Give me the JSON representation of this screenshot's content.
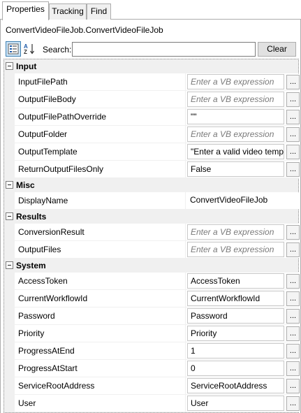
{
  "tabs": [
    "Properties",
    "Tracking",
    "Find"
  ],
  "active_tab": 0,
  "job_title": "ConvertVideoFileJob.ConvertVideoFileJob",
  "toolbar": {
    "categorized_icon": "categorized-sort-icon",
    "alpha_icon": "alphabetical-sort-icon",
    "search_label": "Search:",
    "search_value": "",
    "clear_label": "Clear"
  },
  "categories": [
    {
      "name": "Input",
      "rows": [
        {
          "name": "InputFilePath",
          "value": "Enter a VB expression",
          "placeholder": true,
          "button": true
        },
        {
          "name": "OutputFileBody",
          "value": "Enter a VB expression",
          "placeholder": true,
          "button": true
        },
        {
          "name": "OutputFilePathOverride",
          "value": "\"\"",
          "placeholder": false,
          "button": true
        },
        {
          "name": "OutputFolder",
          "value": "Enter a VB expression",
          "placeholder": true,
          "button": true
        },
        {
          "name": "OutputTemplate",
          "value": "\"Enter a valid video temp",
          "placeholder": false,
          "button": true
        },
        {
          "name": "ReturnOutputFilesOnly",
          "value": "False",
          "placeholder": false,
          "button": true
        }
      ]
    },
    {
      "name": "Misc",
      "rows": [
        {
          "name": "DisplayName",
          "value": "ConvertVideoFileJob",
          "placeholder": false,
          "button": false,
          "plain": true
        }
      ]
    },
    {
      "name": "Results",
      "rows": [
        {
          "name": "ConversionResult",
          "value": "Enter a VB expression",
          "placeholder": true,
          "button": true
        },
        {
          "name": "OutputFiles",
          "value": "Enter a VB expression",
          "placeholder": true,
          "button": true
        }
      ]
    },
    {
      "name": "System",
      "rows": [
        {
          "name": "AccessToken",
          "value": "AccessToken",
          "placeholder": false,
          "button": true
        },
        {
          "name": "CurrentWorkflowId",
          "value": "CurrentWorkflowId",
          "placeholder": false,
          "button": true
        },
        {
          "name": "Password",
          "value": "Password",
          "placeholder": false,
          "button": true
        },
        {
          "name": "Priority",
          "value": "Priority",
          "placeholder": false,
          "button": true
        },
        {
          "name": "ProgressAtEnd",
          "value": "1",
          "placeholder": false,
          "button": true
        },
        {
          "name": "ProgressAtStart",
          "value": "0",
          "placeholder": false,
          "button": true
        },
        {
          "name": "ServiceRootAddress",
          "value": "ServiceRootAddress",
          "placeholder": false,
          "button": true
        },
        {
          "name": "User",
          "value": "User",
          "placeholder": false,
          "button": true
        }
      ]
    }
  ],
  "ellipsis_label": "...",
  "colors": {
    "category_bg": "#f0f0f0",
    "selected_toggle_bg": "#cce4f7",
    "selected_toggle_border": "#3c7fb1",
    "placeholder_text": "#7a7a7a"
  }
}
